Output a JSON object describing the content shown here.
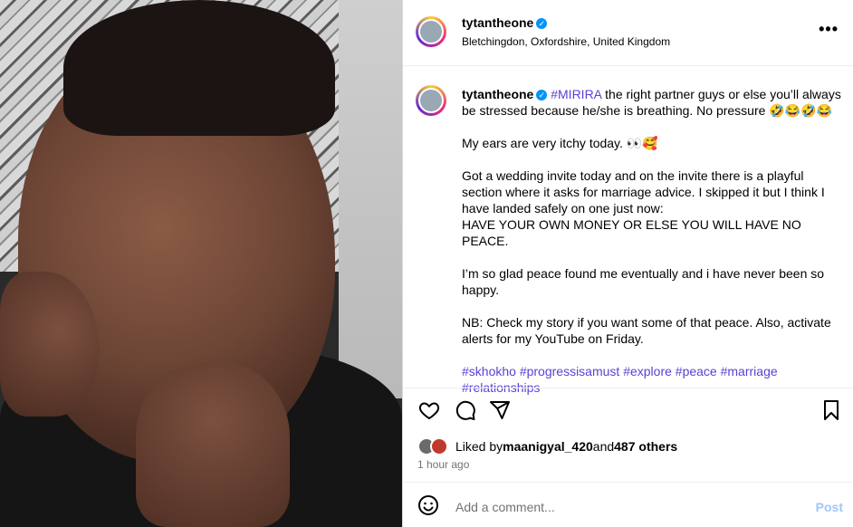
{
  "header": {
    "username": "tytantheone",
    "location": "Bletchingdon, Oxfordshire, United Kingdom",
    "more_label": "•••"
  },
  "caption": {
    "username": "tytantheone",
    "hashtag_lead": "#MIRIRA",
    "para1": " the right partner guys or else you’ll always be stressed because he/she is breathing. No pressure 🤣😂🤣😂",
    "para2": "My ears are very itchy today. 👀🥰",
    "para3": "Got a wedding invite today and on the invite there is a playful section where it asks for marriage advice. I skipped it but I think I have landed safely on one just now:",
    "para3b": "HAVE YOUR OWN MONEY OR ELSE YOU WILL HAVE NO PEACE.",
    "para4": "I’m so glad peace found me eventually and i have never been so happy.",
    "para5": "NB: Check my story if you want some of that peace. Also, activate alerts for my YouTube on Friday.",
    "hashtags": "#skhokho #progressisamust #explore #peace #marriage #relationships"
  },
  "likes": {
    "prefix": "Liked by ",
    "user": "maanigyal_420",
    "middle": " and ",
    "others": "487 others"
  },
  "time": "1 hour ago",
  "comment": {
    "placeholder": "Add a comment...",
    "post_label": "Post"
  },
  "icons": [
    "heart-icon",
    "comment-icon",
    "share-icon",
    "bookmark-icon",
    "emoji-icon",
    "verified-icon",
    "more-icon"
  ]
}
